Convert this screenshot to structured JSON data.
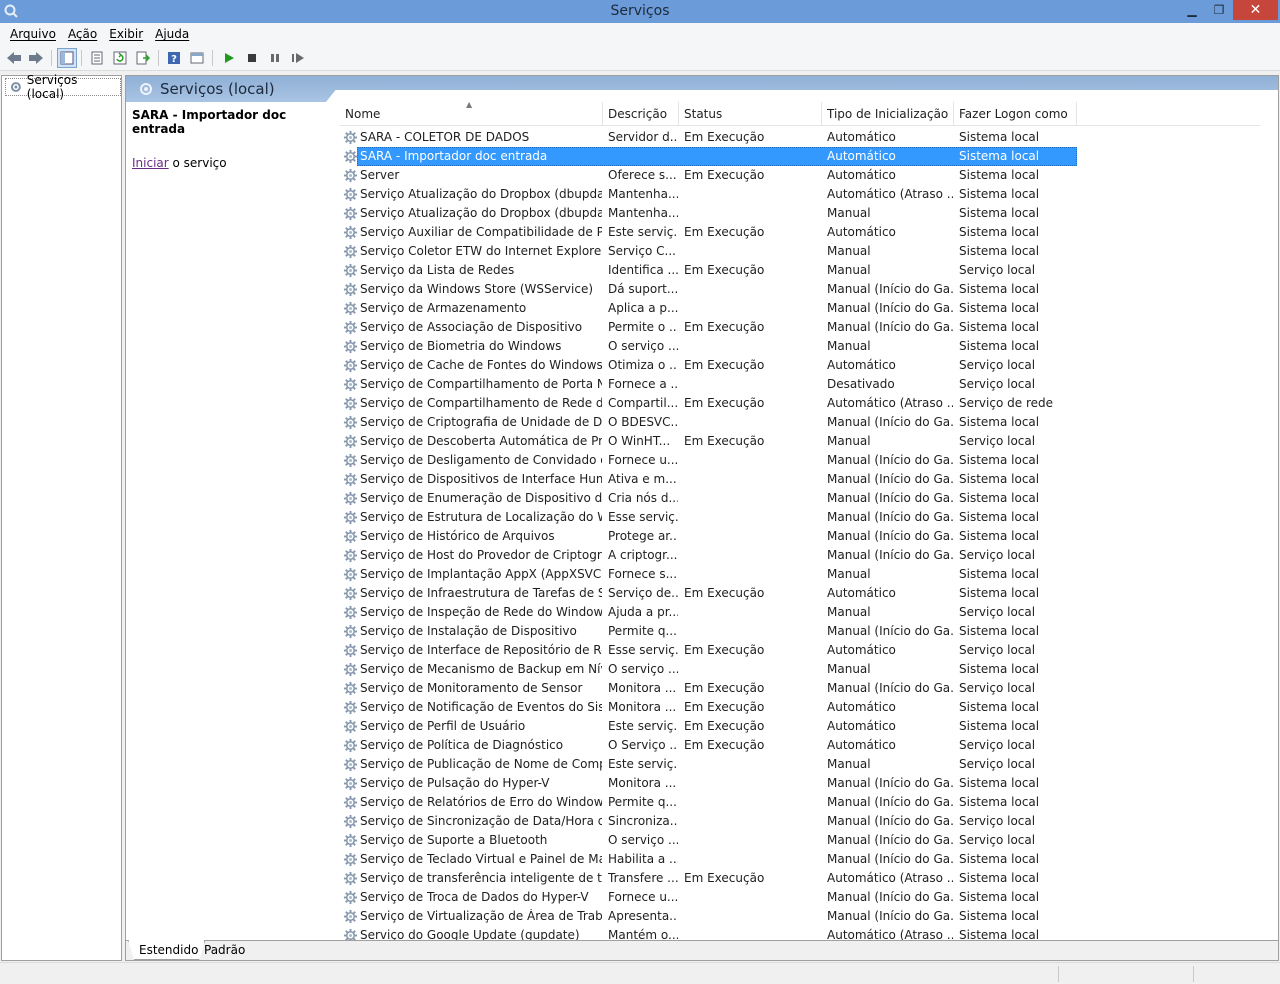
{
  "window": {
    "title": "Serviços"
  },
  "menu": [
    "Arquivo",
    "Ação",
    "Exibir",
    "Ajuda"
  ],
  "toolbar_icons": [
    "back-icon",
    "forward-icon",
    "show-hide-tree-icon",
    "properties-icon",
    "refresh-icon",
    "export-list-icon",
    "help-icon",
    "console-view-icon",
    "start-service-icon",
    "stop-service-icon",
    "pause-service-icon",
    "restart-service-icon"
  ],
  "tree": {
    "root": "Serviços (local)"
  },
  "panel": {
    "title": "Serviços (local)",
    "selected_name": "SARA - Importador doc entrada",
    "action_link": "Iniciar",
    "action_rest": " o serviço"
  },
  "columns": [
    "Nome",
    "Descrição",
    "Status",
    "Tipo de Inicialização",
    "Fazer Logon como"
  ],
  "rows": [
    [
      "SARA - COLETOR DE DADOS",
      "Servidor d...",
      "Em Execução",
      "Automático",
      "Sistema local"
    ],
    [
      "SARA - Importador doc entrada",
      "",
      "",
      "Automático",
      "Sistema local"
    ],
    [
      "Server",
      "Oferece s...",
      "Em Execução",
      "Automático",
      "Sistema local"
    ],
    [
      "Serviço Atualização do Dropbox (dbupdate)",
      "Mantenha...",
      "",
      "Automático (Atraso ...",
      "Sistema local"
    ],
    [
      "Serviço Atualização do Dropbox (dbupdatem)",
      "Mantenha...",
      "",
      "Manual",
      "Sistema local"
    ],
    [
      "Serviço Auxiliar de Compatibilidade de Prog...",
      "Este serviç...",
      "Em Execução",
      "Automático",
      "Sistema local"
    ],
    [
      "Serviço Coletor ETW do Internet Explorer",
      "Serviço C...",
      "",
      "Manual",
      "Sistema local"
    ],
    [
      "Serviço da Lista de Redes",
      "Identifica ...",
      "Em Execução",
      "Manual",
      "Serviço local"
    ],
    [
      "Serviço da Windows Store (WSService)",
      "Dá suport...",
      "",
      "Manual (Início do Ga...",
      "Sistema local"
    ],
    [
      "Serviço de Armazenamento",
      "Aplica a p...",
      "",
      "Manual (Início do Ga...",
      "Sistema local"
    ],
    [
      "Serviço de Associação de Dispositivo",
      "Permite o ...",
      "Em Execução",
      "Manual (Início do Ga...",
      "Sistema local"
    ],
    [
      "Serviço de Biometria do Windows",
      "O serviço ...",
      "",
      "Manual",
      "Sistema local"
    ],
    [
      "Serviço de Cache de Fontes do Windows",
      "Otimiza o ...",
      "Em Execução",
      "Automático",
      "Serviço local"
    ],
    [
      "Serviço de Compartilhamento de Porta Net....",
      "Fornece a ...",
      "",
      "Desativado",
      "Serviço local"
    ],
    [
      "Serviço de Compartilhamento de Rede do ...",
      "Compartil...",
      "Em Execução",
      "Automático (Atraso ...",
      "Serviço de rede"
    ],
    [
      "Serviço de Criptografia de Unidade de Disco...",
      "O BDESVC...",
      "",
      "Manual (Início do Ga...",
      "Sistema local"
    ],
    [
      "Serviço de Descoberta Automática de Proxy...",
      "O WinHT...",
      "Em Execução",
      "Manual",
      "Serviço local"
    ],
    [
      "Serviço de Desligamento de Convidado do ...",
      "Fornece u...",
      "",
      "Manual (Início do Ga...",
      "Sistema local"
    ],
    [
      "Serviço de Dispositivos de Interface Humana",
      "Ativa e m...",
      "",
      "Manual (Início do Ga...",
      "Sistema local"
    ],
    [
      "Serviço de Enumeração de Dispositivo de C...",
      "Cria nós d...",
      "",
      "Manual (Início do Ga...",
      "Sistema local"
    ],
    [
      "Serviço de Estrutura de Localização do Win...",
      "Esse serviç...",
      "",
      "Manual (Início do Ga...",
      "Sistema local"
    ],
    [
      "Serviço de Histórico de Arquivos",
      "Protege ar...",
      "",
      "Manual (Início do Ga...",
      "Sistema local"
    ],
    [
      "Serviço de Host do Provedor de Criptografi...",
      "A criptogr...",
      "",
      "Manual (Início do Ga...",
      "Serviço local"
    ],
    [
      "Serviço de Implantação AppX (AppXSVC)",
      "Fornece s...",
      "",
      "Manual",
      "Sistema local"
    ],
    [
      "Serviço de Infraestrutura de Tarefas de Segu...",
      "Serviço de...",
      "Em Execução",
      "Automático",
      "Sistema local"
    ],
    [
      "Serviço de Inspeção de Rede do Windows D...",
      "Ajuda a pr...",
      "",
      "Manual",
      "Serviço local"
    ],
    [
      "Serviço de Instalação de Dispositivo",
      "Permite q...",
      "",
      "Manual (Início do Ga...",
      "Sistema local"
    ],
    [
      "Serviço de Interface de Repositório de Rede",
      "Esse serviç...",
      "Em Execução",
      "Automático",
      "Serviço local"
    ],
    [
      "Serviço de Mecanismo de Backup em Nível ...",
      "O serviço ...",
      "",
      "Manual",
      "Sistema local"
    ],
    [
      "Serviço de Monitoramento de Sensor",
      "Monitora ...",
      "Em Execução",
      "Manual (Início do Ga...",
      "Serviço local"
    ],
    [
      "Serviço de Notificação de Eventos do Sistema",
      "Monitora ...",
      "Em Execução",
      "Automático",
      "Sistema local"
    ],
    [
      "Serviço de Perfil de Usuário",
      "Este serviç...",
      "Em Execução",
      "Automático",
      "Sistema local"
    ],
    [
      "Serviço de Política de Diagnóstico",
      "O Serviço ...",
      "Em Execução",
      "Automático",
      "Serviço local"
    ],
    [
      "Serviço de Publicação de Nome de Comput...",
      "Este serviç...",
      "",
      "Manual",
      "Serviço local"
    ],
    [
      "Serviço de Pulsação do Hyper-V",
      "Monitora ...",
      "",
      "Manual (Início do Ga...",
      "Sistema local"
    ],
    [
      "Serviço de Relatórios de Erro do Windows",
      "Permite q...",
      "",
      "Manual (Início do Ga...",
      "Sistema local"
    ],
    [
      "Serviço de Sincronização de Data/Hora do ...",
      "Sincroniza...",
      "",
      "Manual (Início do Ga...",
      "Serviço local"
    ],
    [
      "Serviço de Suporte a Bluetooth",
      "O serviço ...",
      "",
      "Manual (Início do Ga...",
      "Serviço local"
    ],
    [
      "Serviço de Teclado Virtual e Painel de Manu...",
      "Habilita a ...",
      "",
      "Manual (Início do Ga...",
      "Sistema local"
    ],
    [
      "Serviço de transferência inteligente de tela ...",
      "Transfere ...",
      "Em Execução",
      "Automático (Atraso ...",
      "Sistema local"
    ],
    [
      "Serviço de Troca de Dados do Hyper-V",
      "Fornece u...",
      "",
      "Manual (Início do Ga...",
      "Sistema local"
    ],
    [
      "Serviço de Virtualização de Área de Trabalh...",
      "Apresenta...",
      "",
      "Manual (Início do Ga...",
      "Sistema local"
    ],
    [
      "Serviço do Google Update (gupdate)",
      "Mantém o...",
      "",
      "Automático (Atraso ...",
      "Sistema local"
    ]
  ],
  "selected_row": 1,
  "tabs": [
    "Estendido",
    "Padrão"
  ],
  "colors": {
    "selection": "#3399ff",
    "titlebar": "#6b9bd8",
    "close": "#c7463b",
    "link": "#6c2b86"
  }
}
